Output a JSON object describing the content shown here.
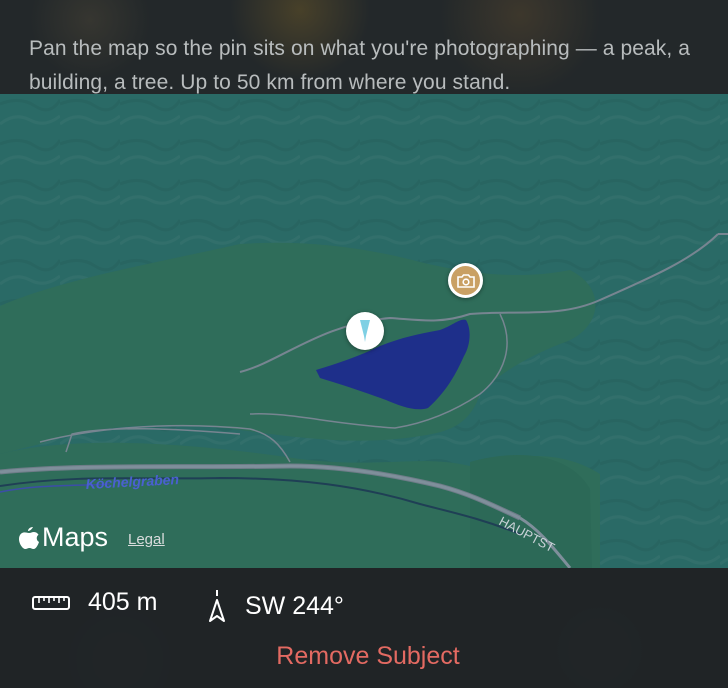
{
  "instructions": "Pan the map so the pin sits on what you're photographing — a peak, a building, a tree. Up to 50 km from where you stand.",
  "map": {
    "stream_label": "Köchelgraben",
    "road_label": "HAUPTST",
    "attribution_brand": "Maps",
    "legal_label": "Legal"
  },
  "stats": {
    "distance": "405 m",
    "bearing": "SW 244°"
  },
  "actions": {
    "remove_subject": "Remove Subject"
  },
  "icons": {
    "pin": "subject-pin-icon",
    "camera": "camera-location-icon",
    "ruler": "ruler-icon",
    "bearing": "compass-arrow-icon",
    "apple": "apple-logo-icon"
  },
  "colors": {
    "map_hills": "#2a6a66",
    "map_valley": "#2f6d5a",
    "lake": "#1e2f8a",
    "camera_accent": "#c9a064",
    "destructive": "#e36a62"
  }
}
